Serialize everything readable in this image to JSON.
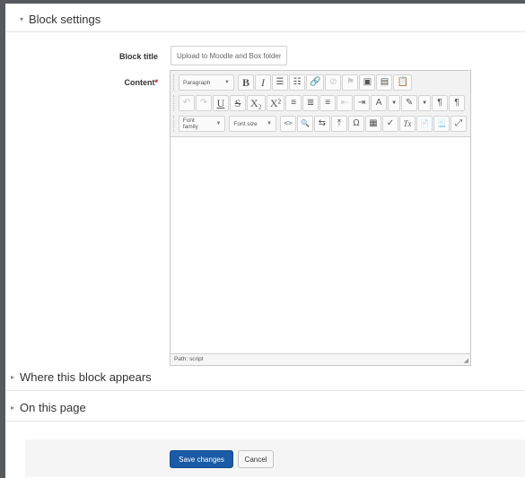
{
  "sections": {
    "block_settings": {
      "title": "Block settings",
      "toggle": "▾"
    },
    "where_appears": {
      "title": "Where this block appears",
      "toggle": "▸"
    },
    "on_this_page": {
      "title": "On this page",
      "toggle": "▸"
    }
  },
  "form": {
    "block_title_label": "Block title",
    "block_title_value": "Upload to Moodle and Box folder",
    "content_label": "Content",
    "required_mark": "*"
  },
  "editor": {
    "paragraph_select": "Paragraph",
    "font_family_select": "Font family",
    "font_size_select": "Font size",
    "path_text": "Path: script",
    "icons": {
      "bold": "B",
      "italic": "I",
      "bullet_list": "☰",
      "numbered_list": "☷",
      "link": "🔗",
      "unlink": "⊘",
      "anchor": "⚑",
      "image": "▣",
      "media": "▤",
      "paste": "📋",
      "undo": "↶",
      "redo": "↷",
      "underline": "U",
      "strikethrough": "S",
      "subscript": "X₂",
      "superscript": "X²",
      "align_left": "≡",
      "align_center": "≣",
      "align_right": "≡",
      "outdent": "⇤",
      "indent": "⇥",
      "text_color": "A",
      "bg_color": "✎",
      "ltr": "¶",
      "rtl": "¶",
      "code": "<>",
      "find": "🔍",
      "replace": "⇆",
      "upload": "⤒",
      "special_char": "Ω",
      "table": "▦",
      "clear": "✓",
      "remove_format": "Tx",
      "paste_text": "📄",
      "paste_word": "📃",
      "fullscreen": "⤢",
      "resize": "◢",
      "caret": "▼"
    }
  },
  "buttons": {
    "save": "Save changes",
    "cancel": "Cancel"
  },
  "colors": {
    "primary_button": "#1a5aa6",
    "required": "#cc0000",
    "frame": "#555a5e"
  }
}
